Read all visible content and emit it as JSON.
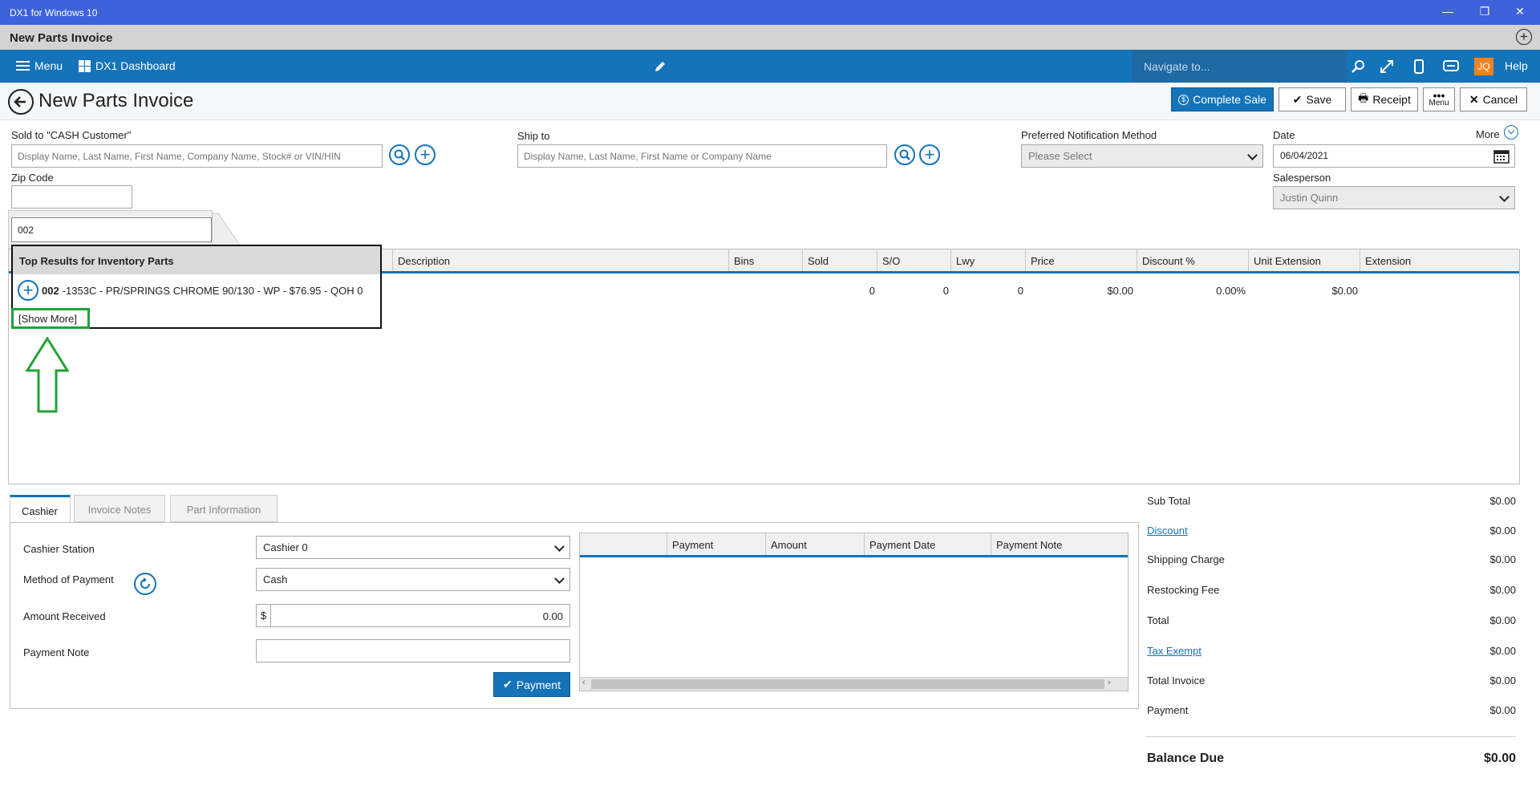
{
  "window": {
    "title": "DX1 for Windows 10",
    "min": "—",
    "restore": "❐",
    "close": "✕"
  },
  "app": {
    "title": "New Parts Invoice",
    "add": "+"
  },
  "nav": {
    "menu": "Menu",
    "dashboard": "DX1 Dashboard",
    "navigate_placeholder": "Navigate to...",
    "avatar": "JQ",
    "help": "Help"
  },
  "header": {
    "title": "New Parts Invoice",
    "complete_sale": "Complete Sale",
    "save": "Save",
    "receipt": "Receipt",
    "menu": "Menu",
    "cancel": "Cancel"
  },
  "form": {
    "sold_to_label": "Sold to  \"CASH Customer\"",
    "sold_to_placeholder": "Display Name, Last Name, First Name, Company Name, Stock# or VIN/HIN",
    "ship_to_label": "Ship to",
    "ship_to_placeholder": "Display Name, Last Name, First Name or Company Name",
    "notif_label": "Preferred Notification Method",
    "notif_value": "Please Select",
    "date_label": "Date",
    "date_value": "06/04/2021",
    "more_label": "More",
    "zip_label": "Zip Code",
    "zip_value": "",
    "salesperson_label": "Salesperson",
    "salesperson_value": "Justin Quinn",
    "search_value": "002"
  },
  "grid": {
    "columns": [
      "Description",
      "Bins",
      "Sold",
      "S/O",
      "Lwy",
      "Price",
      "Discount %",
      "Unit Extension",
      "Extension"
    ],
    "row": {
      "sold": "0",
      "so": "0",
      "lwy": "0",
      "price": "$0.00",
      "discount": "0.00%",
      "unit_ext": "$0.00"
    }
  },
  "dropdown": {
    "header": "Top Results for Inventory Parts",
    "item_bold": "002",
    "item_rest": "-1353C - PR/SPRINGS CHROME 90/130 - WP - $76.95 - QOH 0",
    "show_more": "[Show More]"
  },
  "tabs": [
    "Cashier",
    "Invoice Notes",
    "Part Information"
  ],
  "cashier": {
    "station_label": "Cashier Station",
    "station_value": "Cashier 0",
    "method_label": "Method of Payment",
    "method_value": "Cash",
    "amount_label": "Amount Received",
    "currency": "$",
    "amount_value": "0.00",
    "note_label": "Payment Note",
    "note_value": "",
    "payment_button": "Payment"
  },
  "payments": {
    "columns": [
      "Payment",
      "Amount",
      "Payment Date",
      "Payment Note"
    ]
  },
  "totals": [
    {
      "label": "Sub Total",
      "value": "$0.00",
      "link": false
    },
    {
      "label": "Discount",
      "value": "$0.00",
      "link": true
    },
    {
      "label": "Shipping Charge",
      "value": "$0.00",
      "link": false
    },
    {
      "label": "Restocking Fee",
      "value": "$0.00",
      "link": false
    },
    {
      "label": "Total",
      "value": "$0.00",
      "link": false
    },
    {
      "label": "Tax Exempt",
      "value": "$0.00",
      "link": true
    },
    {
      "label": "Total Invoice",
      "value": "$0.00",
      "link": false
    },
    {
      "label": "Payment",
      "value": "$0.00",
      "link": false
    }
  ],
  "balance": {
    "label": "Balance Due",
    "value": "$0.00"
  },
  "colors": {
    "accent": "#1473b9",
    "titlebar": "#3e62d9",
    "highlight": "#21a336",
    "avatar": "#f58220"
  }
}
